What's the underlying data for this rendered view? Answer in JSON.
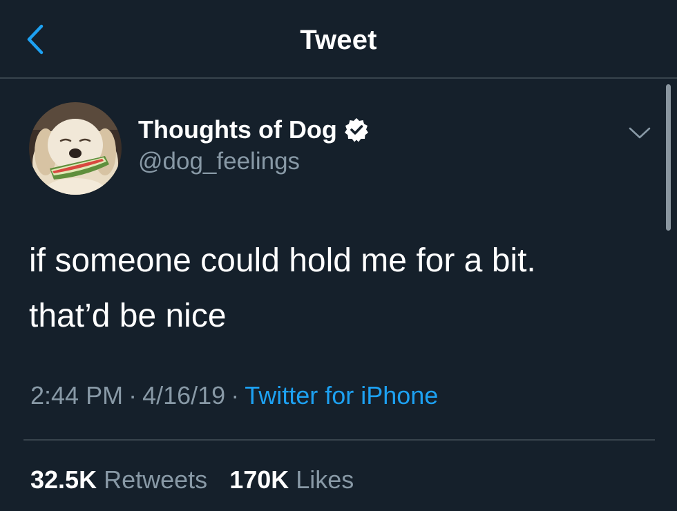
{
  "header": {
    "title": "Tweet",
    "back_icon": "chevron-left-icon"
  },
  "tweet": {
    "author": {
      "display_name": "Thoughts of Dog",
      "handle": "@dog_feelings",
      "verified": true
    },
    "text_lines": [
      "if someone could hold me for a bit.",
      "that’d be nice"
    ],
    "time": "2:44 PM",
    "date": "4/16/19",
    "separator": "·",
    "source": "Twitter for iPhone",
    "retweets_count": "32.5K",
    "retweets_label": "Retweets",
    "likes_count": "170K",
    "likes_label": "Likes"
  },
  "colors": {
    "background": "#15202b",
    "accent": "#1da1f2",
    "secondary_text": "#8899a6",
    "divider": "#38444d"
  }
}
